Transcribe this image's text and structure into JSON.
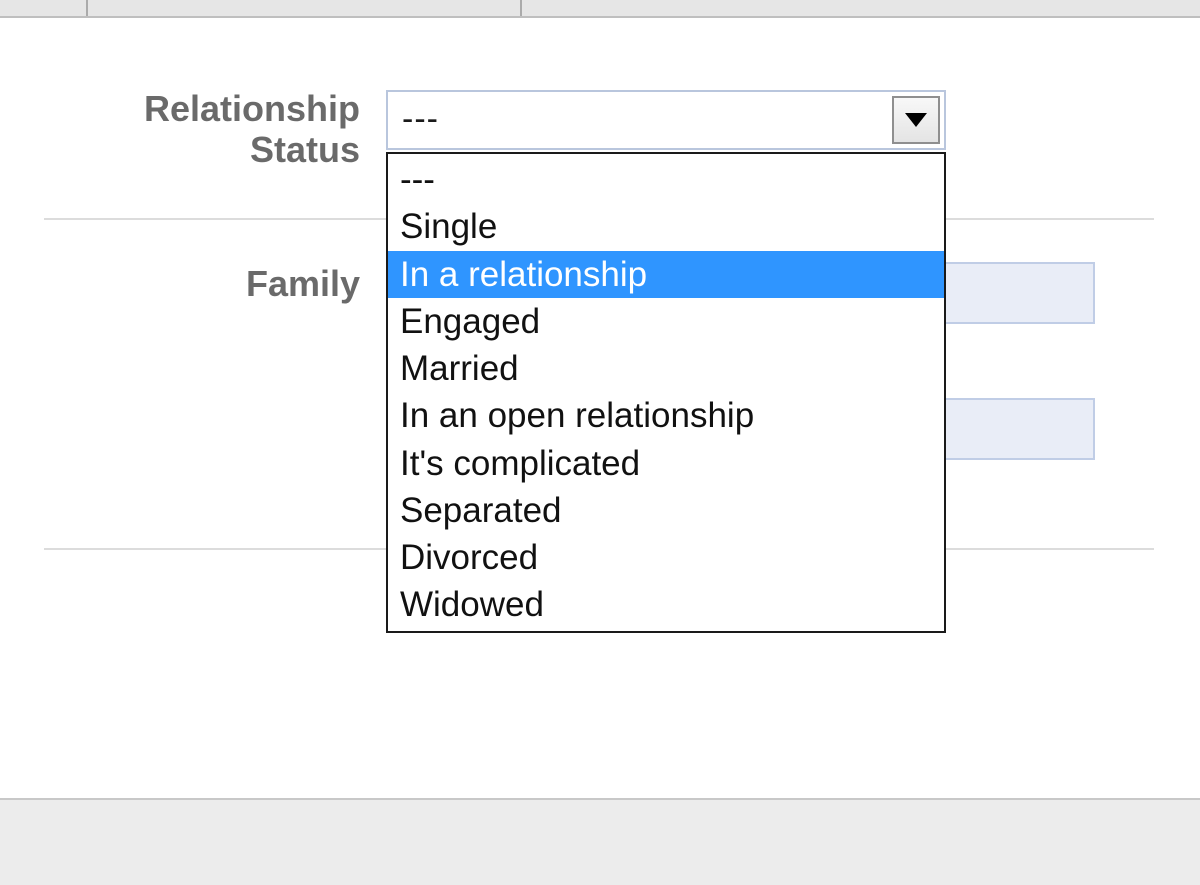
{
  "labels": {
    "relationship_status": "Relationship Status",
    "family": "Family"
  },
  "relationship_select": {
    "selected_value": "---",
    "highlighted_index": 2,
    "options": [
      "---",
      "Single",
      "In a relationship",
      "Engaged",
      "Married",
      "In an open relationship",
      "It's complicated",
      "Separated",
      "Divorced",
      "Widowed"
    ]
  }
}
